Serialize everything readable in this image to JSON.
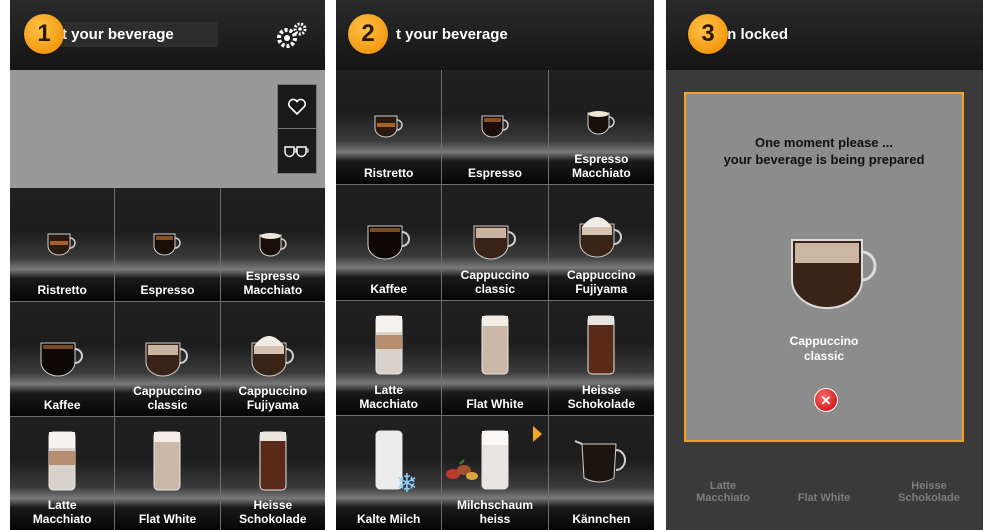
{
  "panels": [
    {
      "step": "1",
      "title": "t your beverage",
      "icons": {
        "settings": "gear-icon",
        "favorites": "heart-icon",
        "double": "double-cup-icon"
      },
      "tiles": [
        {
          "label": "Ristretto"
        },
        {
          "label": "Espresso"
        },
        {
          "label": "Espresso\nMacchiato"
        },
        {
          "label": "Kaffee"
        },
        {
          "label": "Cappuccino\nclassic"
        },
        {
          "label": "Cappuccino\nFujiyama"
        },
        {
          "label": "Latte\nMacchiato"
        },
        {
          "label": "Flat White"
        },
        {
          "label": "Heisse\nSchokolade"
        }
      ]
    },
    {
      "step": "2",
      "title": "t your beverage",
      "tiles": [
        {
          "label": "Ristretto"
        },
        {
          "label": "Espresso"
        },
        {
          "label": "Espresso\nMacchiato"
        },
        {
          "label": "Kaffee"
        },
        {
          "label": "Cappuccino\nclassic"
        },
        {
          "label": "Cappuccino\nFujiyama"
        },
        {
          "label": "Latte\nMacchiato"
        },
        {
          "label": "Flat White"
        },
        {
          "label": "Heisse\nSchokolade"
        },
        {
          "label": "Kalte Milch"
        },
        {
          "label": "Milchschaum\nheiss"
        },
        {
          "label": "Kännchen"
        }
      ]
    },
    {
      "step": "3",
      "title": "on locked",
      "dialog": {
        "message": "One moment please ...\nyour beverage is being prepared",
        "beverage": "Cappuccino\nclassic"
      },
      "background_labels": [
        "Latte\nMacchiato",
        "Flat White",
        "Heisse\nSchokolade"
      ]
    }
  ],
  "colors": {
    "accent": "#f5a623",
    "cancel": "#d41f1f"
  }
}
